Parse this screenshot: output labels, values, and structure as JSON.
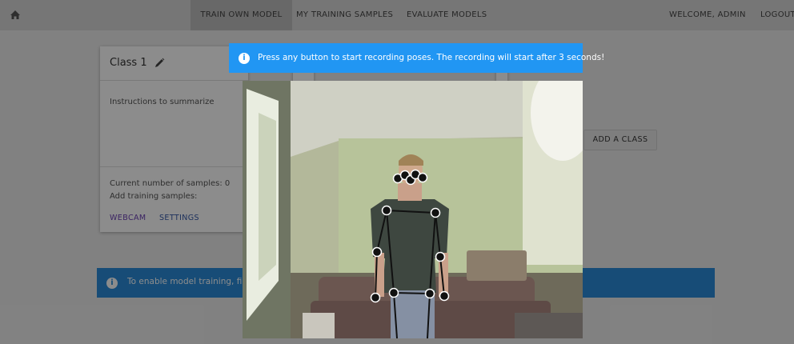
{
  "nav": {
    "items": [
      {
        "label": "TRAIN OWN MODEL",
        "active": true
      },
      {
        "label": "MY TRAINING SAMPLES",
        "active": false
      },
      {
        "label": "EVALUATE MODELS",
        "active": false
      }
    ],
    "welcome": "WELCOME, ADMIN",
    "logout": "LOGOUT"
  },
  "class_card": {
    "title": "Class 1",
    "instructions": "Instructions to summarize",
    "samples_text": "Current number of samples: 0",
    "add_samples_text": "Add training samples:",
    "webcam_label": "WEBCAM",
    "settings_label": "SETTINGS"
  },
  "add_class_label": "ADD A CLASS",
  "bottom_banner": {
    "text": "To enable model training, first"
  },
  "notice": {
    "text": "Press any button to start recording poses. The recording will start after 3 seconds!"
  },
  "colors": {
    "notice_bg": "#2196f3",
    "banner_bg": "#2a8bd9",
    "webcam_link": "#6a3fb3",
    "settings_link": "#3559a8"
  }
}
